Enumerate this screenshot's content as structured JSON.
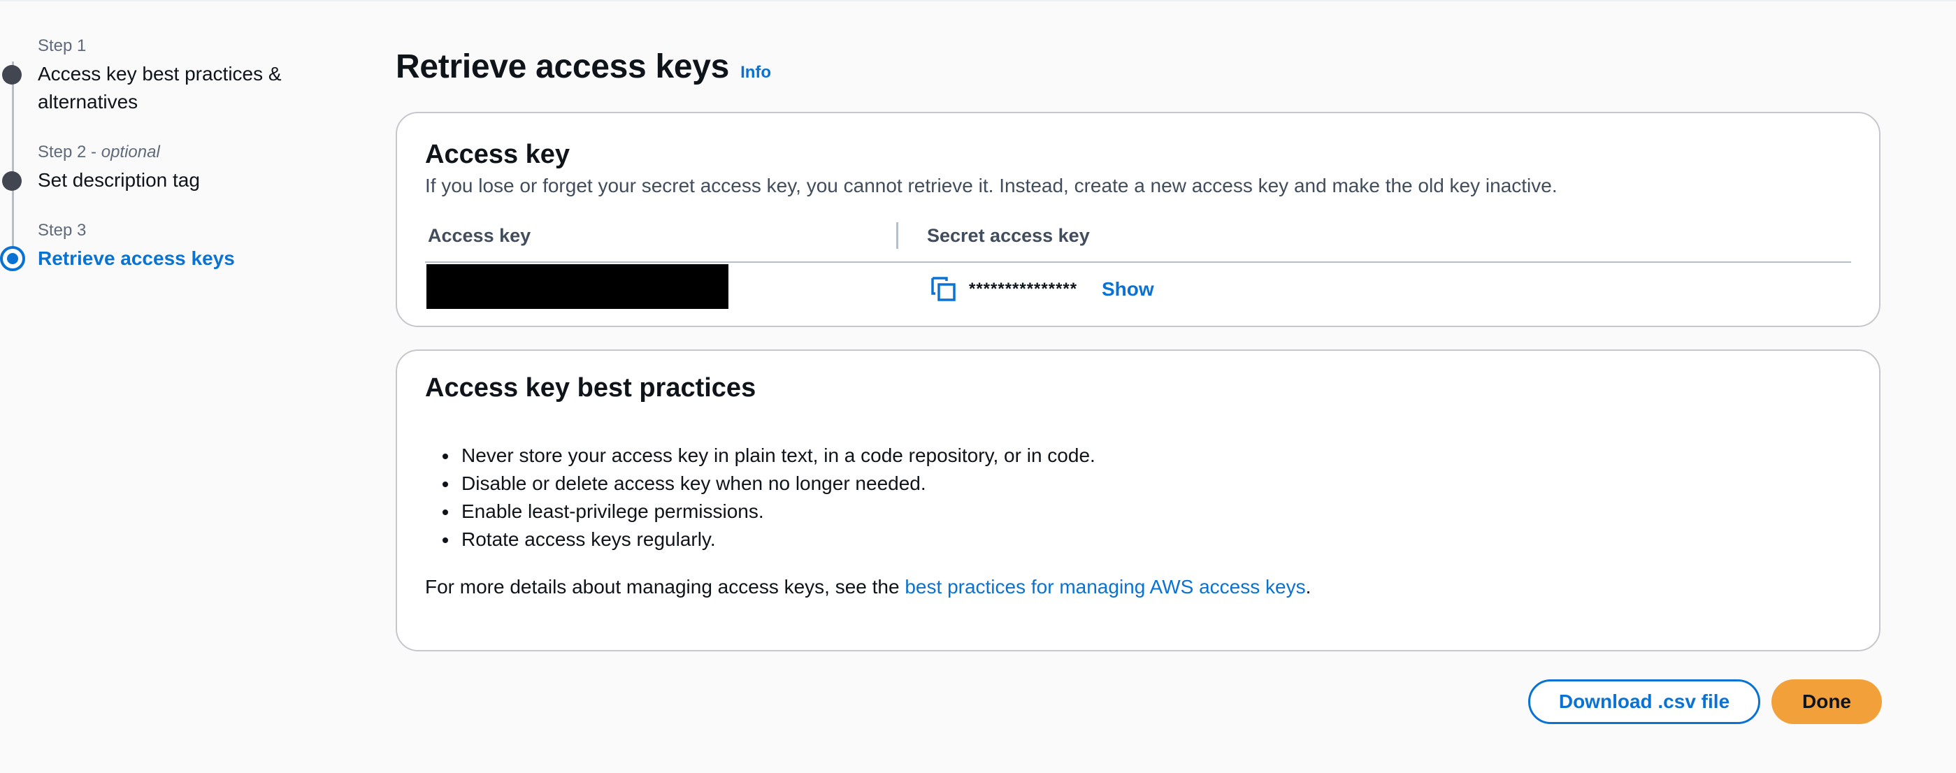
{
  "wizard": {
    "steps": [
      {
        "number": "Step 1",
        "optional": "",
        "title": "Access key best practices & alternatives",
        "state": "completed"
      },
      {
        "number": "Step 2",
        "optional": "optional",
        "title": "Set description tag",
        "state": "completed"
      },
      {
        "number": "Step 3",
        "optional": "",
        "title": "Retrieve access keys",
        "state": "active"
      }
    ],
    "optional_separator": " - "
  },
  "header": {
    "title": "Retrieve access keys",
    "info_link": "Info"
  },
  "access_key_panel": {
    "title": "Access key",
    "description": "If you lose or forget your secret access key, you cannot retrieve it. Instead, create a new access key and make the old key inactive.",
    "columns": [
      "Access key",
      "Secret access key"
    ],
    "secret_masked": "***************",
    "show_label": "Show",
    "copy_icon": "copy-icon",
    "access_key_value_redacted": true
  },
  "best_practices_panel": {
    "title": "Access key best practices",
    "items": [
      "Never store your access key in plain text, in a code repository, or in code.",
      "Disable or delete access key when no longer needed.",
      "Enable least-privilege permissions.",
      "Rotate access keys regularly."
    ],
    "details_prefix": "For more details about managing access keys, see the ",
    "details_link": "best practices for managing AWS access keys",
    "details_suffix": "."
  },
  "actions": {
    "download_label": "Download .csv file",
    "done_label": "Done"
  },
  "colors": {
    "link": "#0972d3",
    "primary_button": "#f2a13a",
    "step_completed": "#424650",
    "text": "#0f141a"
  }
}
